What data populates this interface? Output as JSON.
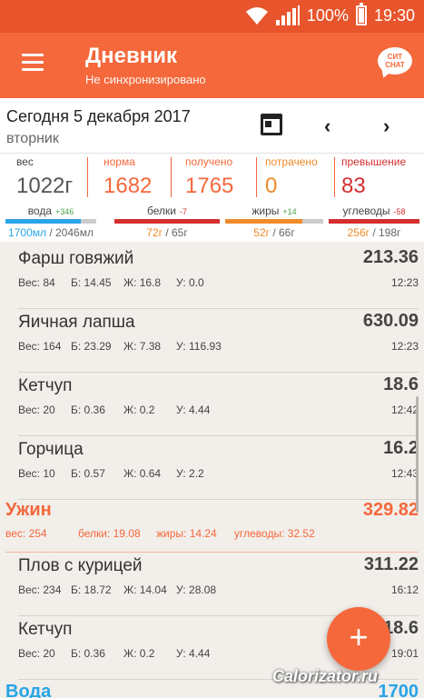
{
  "status": {
    "battery": "100%",
    "time": "19:30"
  },
  "appbar": {
    "title": "Дневник",
    "subtitle": "Не синхронизировано",
    "chat_logo": "СИТ CHAT"
  },
  "date": {
    "label": "Сегодня 5 декабря 2017",
    "weekday": "вторник"
  },
  "stats": {
    "weight": {
      "label": "вес",
      "value": "1022г"
    },
    "norm": {
      "label": "норма",
      "value": "1682"
    },
    "received": {
      "label": "получено",
      "value": "1765"
    },
    "spent": {
      "label": "потрачено",
      "value": "0"
    },
    "excess": {
      "label": "превышение",
      "value": "83"
    }
  },
  "macros": {
    "water": {
      "label": "вода",
      "delta": "+346",
      "value": "1700мл",
      "norm": " / 2046мл",
      "progress": 0.83
    },
    "protein": {
      "label": "белки",
      "delta": "-7",
      "value": "72г",
      "norm": " / 65г",
      "progress": 1.0
    },
    "fat": {
      "label": "жиры",
      "delta": "+14",
      "value": "52г",
      "norm": " / 66г",
      "progress": 0.79
    },
    "carbs": {
      "label": "углеводы",
      "delta": "-58",
      "value": "256г",
      "norm": " / 198г",
      "progress": 1.0
    }
  },
  "items": [
    {
      "name": "Фарш говяжий",
      "kcal": "213.36",
      "w": "Вес: 84",
      "p": "Б: 14.45",
      "f": "Ж: 16.8",
      "c": "У: 0.0",
      "time": "12:23"
    },
    {
      "name": "Яичная лапша",
      "kcal": "630.09",
      "w": "Вес: 164",
      "p": "Б: 23.29",
      "f": "Ж: 7.38",
      "c": "У: 116.93",
      "time": "12:23"
    },
    {
      "name": "Кетчуп",
      "kcal": "18.6",
      "w": "Вес: 20",
      "p": "Б: 0.36",
      "f": "Ж: 0.2",
      "c": "У: 4.44",
      "time": "12:42"
    },
    {
      "name": "Горчица",
      "kcal": "16.2",
      "w": "Вес: 10",
      "p": "Б: 0.57",
      "f": "Ж: 0.64",
      "c": "У: 2.2",
      "time": "12:43"
    },
    {
      "name": "Плов с курицей",
      "kcal": "311.22",
      "w": "Вес: 234",
      "p": "Б: 18.72",
      "f": "Ж: 14.04",
      "c": "У: 28.08",
      "time": "16:12"
    },
    {
      "name": "Кетчуп",
      "kcal": "18.6",
      "w": "Вес: 20",
      "p": "Б: 0.36",
      "f": "Ж: 0.2",
      "c": "У: 4.44",
      "time": "19:01"
    }
  ],
  "dinner": {
    "name": "Ужин",
    "kcal": "329.82",
    "w": "вес: 254",
    "p": "белки: 19.08",
    "f": "жиры: 14.24",
    "c": "углеводы: 32.52"
  },
  "water_section": {
    "name": "Вода",
    "value": "1700"
  },
  "fab_label": "+",
  "watermark": "Calorizator.ru",
  "colors": {
    "accent": "#f4683b",
    "water": "#28a4e6",
    "green": "#43a047",
    "red": "#d32f2f",
    "orange": "#ef8a2a"
  }
}
